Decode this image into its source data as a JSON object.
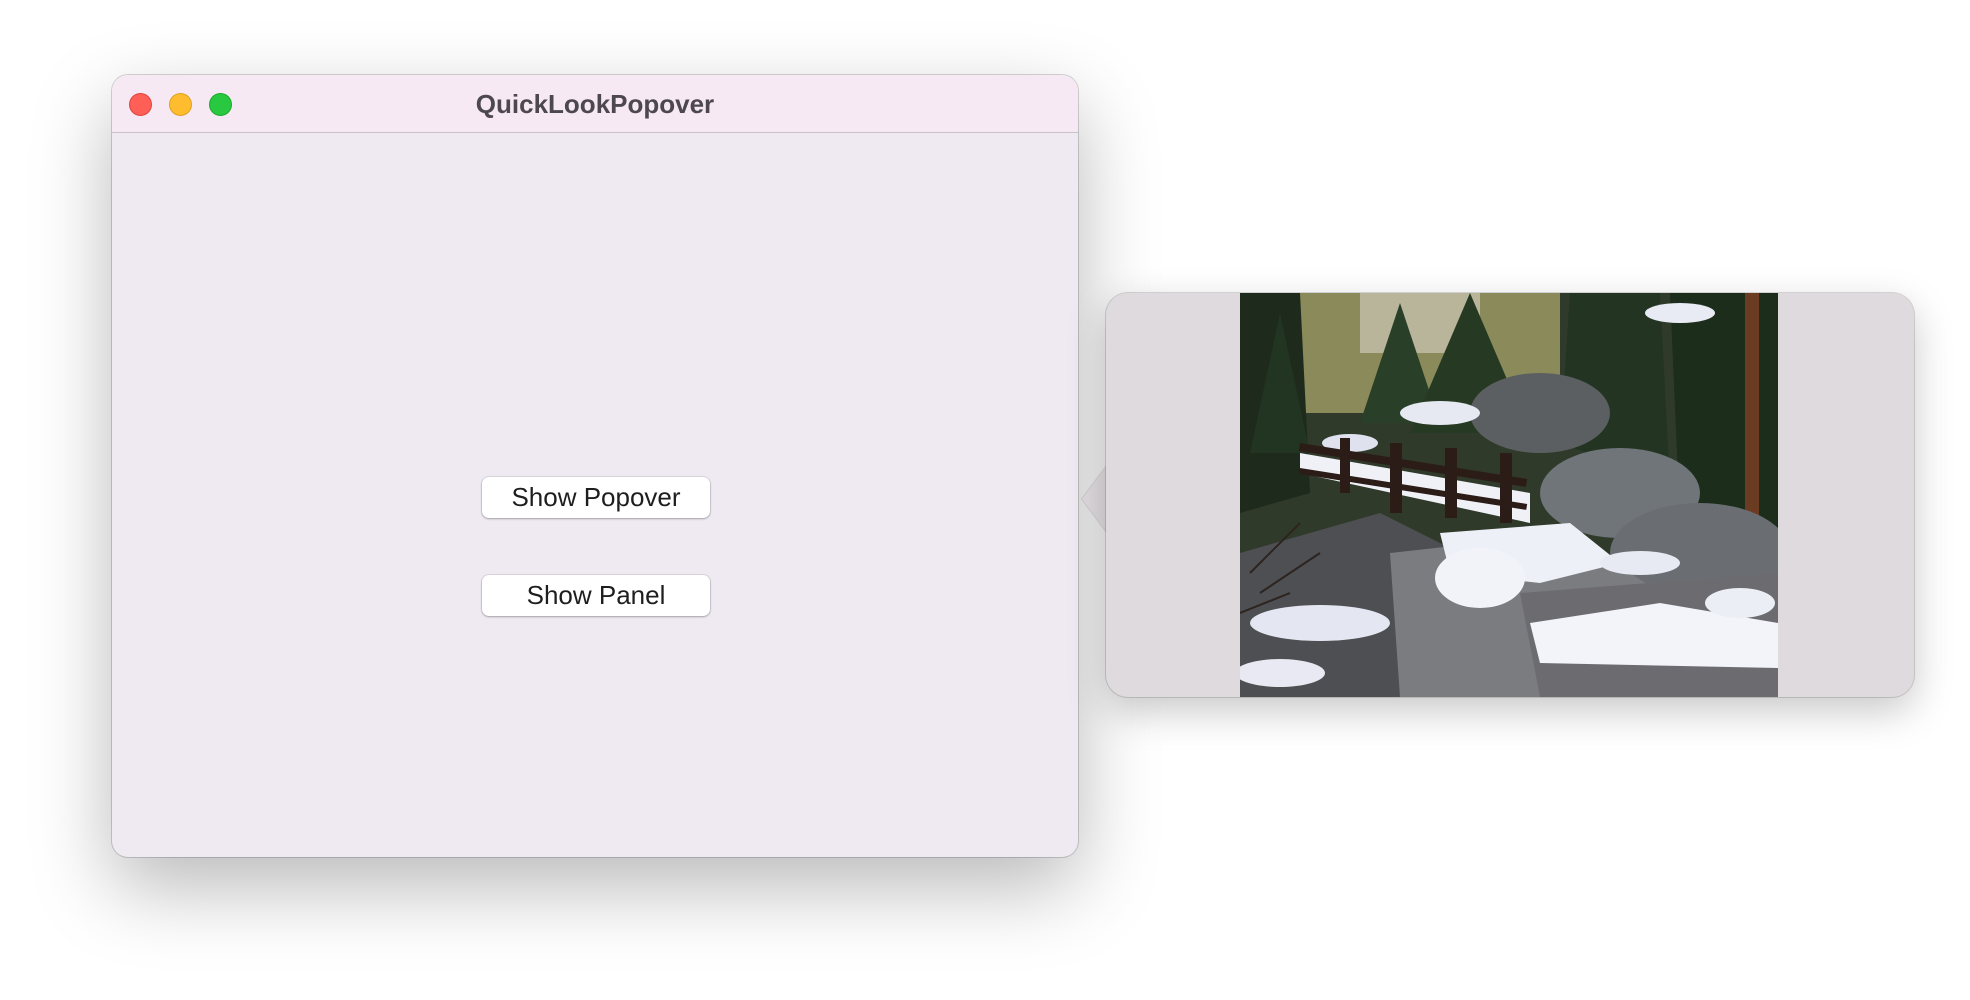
{
  "window": {
    "title": "QuickLookPopover",
    "buttons": {
      "show_popover": "Show Popover",
      "show_panel": "Show Panel"
    }
  },
  "popover": {
    "preview_subject": "snowy trail with wooden bridge in forest"
  },
  "icons": {
    "close": "close-icon",
    "minimize": "minimize-icon",
    "zoom": "zoom-icon"
  },
  "colors": {
    "close": "#fe5f57",
    "minimize": "#febc2e",
    "zoom": "#28c840"
  }
}
